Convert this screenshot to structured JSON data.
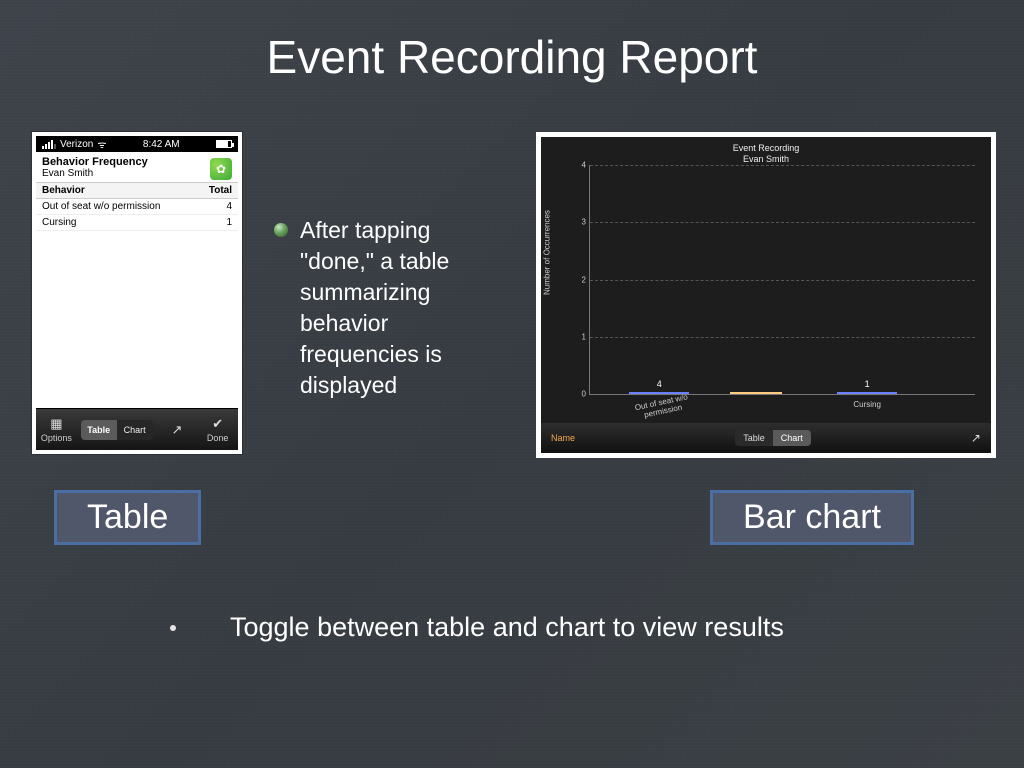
{
  "slide": {
    "title": "Event Recording Report",
    "center_note": "After tapping \"done,\" a table summarizing behavior frequencies is displayed",
    "highlight_left": "Table",
    "highlight_right": "Bar chart",
    "bottom_note": "Toggle between table and chart to view results"
  },
  "phone": {
    "carrier": "Verizon",
    "time": "8:42 AM",
    "header_title": "Behavior Frequency",
    "header_sub": "Evan Smith",
    "table": {
      "col1": "Behavior",
      "col2": "Total",
      "rows": [
        {
          "label": "Out of seat w/o permission",
          "value": "4"
        },
        {
          "label": "Cursing",
          "value": "1"
        }
      ]
    },
    "tabs": {
      "options": "Options",
      "seg_table": "Table",
      "seg_chart": "Chart",
      "done": "Done"
    }
  },
  "chart_data": {
    "type": "bar",
    "title": "Event Recording",
    "subtitle": "Evan Smith",
    "ylabel": "Number of Occurrences",
    "ylim": [
      0,
      4
    ],
    "yticks": [
      0,
      1,
      2,
      3,
      4
    ],
    "categories": [
      "Out of seat w/o permission",
      "Cursing"
    ],
    "values": [
      4,
      1
    ],
    "colors": [
      "#1f2be0",
      "#1f2be0"
    ],
    "grid": true,
    "legend": false,
    "bottom_left_label": "Name",
    "bottom_seg": {
      "left": "Table",
      "right": "Chart",
      "active": "Chart"
    }
  }
}
